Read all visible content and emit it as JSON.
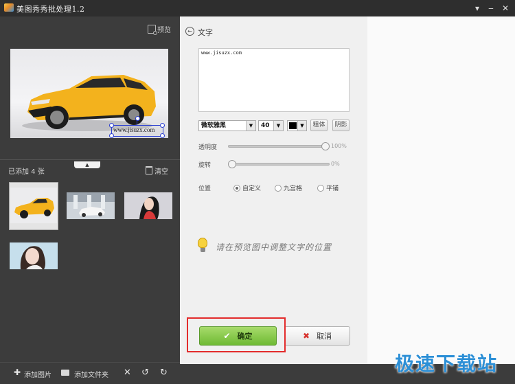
{
  "window": {
    "title": "美图秀秀批处理1.2",
    "menu_icon": "▾",
    "min_icon": "‒",
    "close_icon": "✕"
  },
  "left": {
    "preview_label": "预览",
    "watermark_preview_text": "www.jisuzx.com",
    "collapse_icon": "▲",
    "count_text": "已添加 4 张",
    "clear_label": "清空",
    "bottom": {
      "add_image_label": "添加图片",
      "add_folder_label": "添加文件夹",
      "delete_icon": "✕",
      "rotate_left_icon": "↺",
      "rotate_right_icon": "↻"
    }
  },
  "panel": {
    "title": "文字",
    "text_value": "www.jisuzx.com",
    "font_value": "微软雅黑",
    "size_value": "40",
    "color_value": "#000000",
    "bold_label": "粗体",
    "shadow_label": "阴影",
    "opacity": {
      "label": "透明度",
      "value": 1.0,
      "display": "100%"
    },
    "rotate": {
      "label": "旋转",
      "value": 0,
      "display": "0%"
    },
    "position": {
      "label": "位置",
      "options": [
        {
          "label": "自定义",
          "selected": true
        },
        {
          "label": "九宫格",
          "selected": false
        },
        {
          "label": "平铺",
          "selected": false
        }
      ]
    },
    "hint": "请在预览图中调整文字的位置",
    "ok_label": "确定",
    "cancel_label": "取消"
  },
  "watermark": "极速下载站"
}
